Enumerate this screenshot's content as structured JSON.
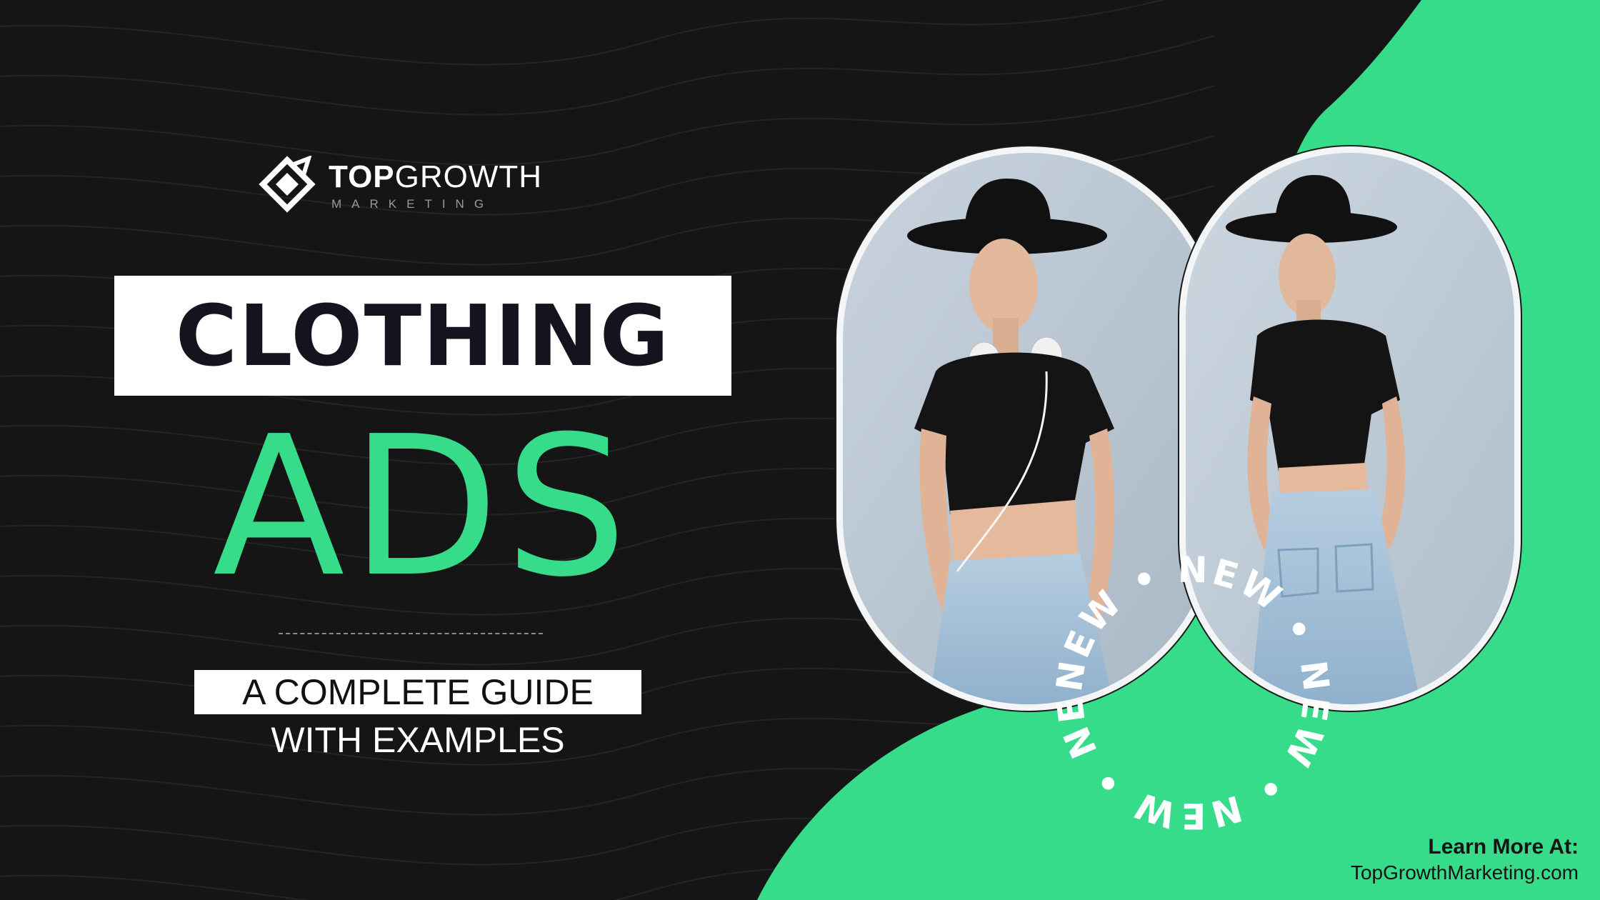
{
  "brand": {
    "name_bold": "TOP",
    "name_regular": "GROWTH",
    "sub": "MARKETING"
  },
  "headline": {
    "line1": "CLOTHING",
    "line2": "ADS"
  },
  "subtitle": {
    "line1": "A COMPLETE GUIDE",
    "line2": "WITH EXAMPLES"
  },
  "badge": {
    "text": "NEW • NEW • NEW • NEW • NEW • "
  },
  "footer": {
    "label": "Learn More At:",
    "url": "TopGrowthMarketing.com"
  },
  "photos": [
    {
      "subject": "woman-front-view"
    },
    {
      "subject": "woman-back-view"
    }
  ],
  "colors": {
    "background": "#151515",
    "accent_green": "#37dc8b",
    "title_dark": "#14141f",
    "white": "#ffffff"
  }
}
